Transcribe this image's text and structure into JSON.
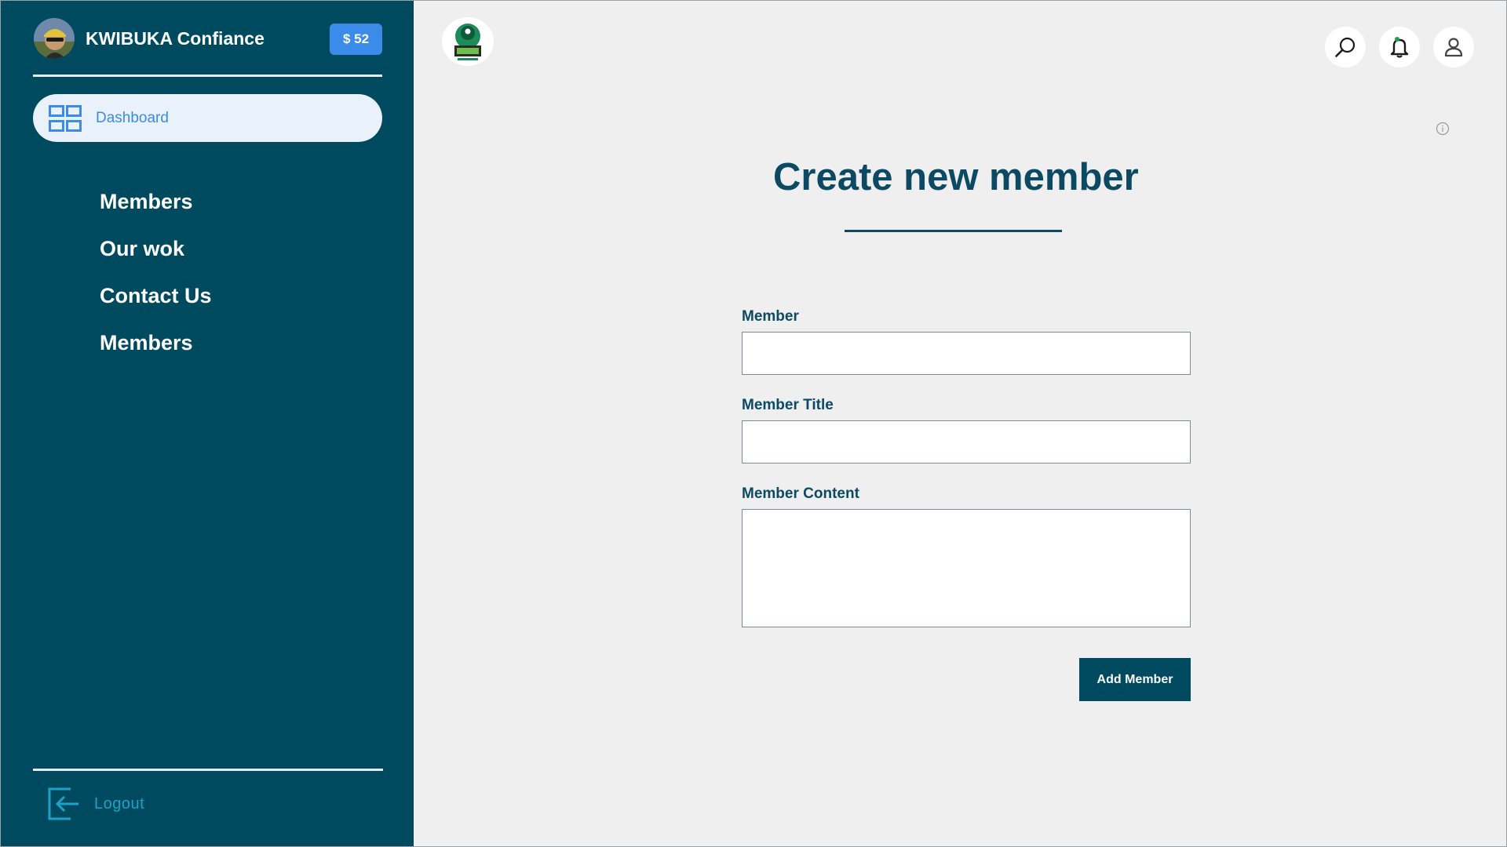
{
  "sidebar": {
    "brand": {
      "name": "KWIBUKA Confiance",
      "balance": "$ 52",
      "balance_color": "#3b8ce8"
    },
    "dashboard": {
      "label": "Dashboard",
      "icon": "grid-icon"
    },
    "nav_items": [
      {
        "label": "Members"
      },
      {
        "label": "Our wok"
      },
      {
        "label": "Contact Us"
      },
      {
        "label": "Members"
      }
    ],
    "logout": {
      "label": "Logout",
      "icon": "logout-icon"
    },
    "background_color": "#004a60"
  },
  "topbar": {
    "icons": [
      "search-icon",
      "bell-icon",
      "user-icon"
    ]
  },
  "main": {
    "title": "Create new member",
    "fields": [
      {
        "label": "Member",
        "value": "",
        "placeholder": ""
      },
      {
        "label": "Member Title",
        "value": "",
        "placeholder": ""
      },
      {
        "label": "Member Content",
        "value": "",
        "placeholder": ""
      }
    ],
    "submit_label": "Add Member",
    "accent_color": "#0b4a62"
  }
}
